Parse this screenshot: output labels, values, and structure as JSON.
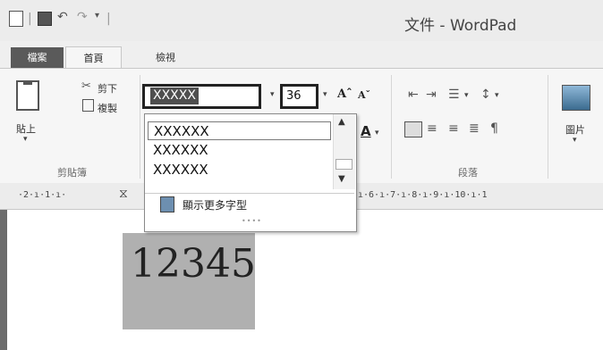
{
  "window": {
    "title": "文件 - WordPad"
  },
  "tabs": {
    "file": "檔案",
    "home": "首頁",
    "view": "檢視"
  },
  "clipboard": {
    "paste": "貼上",
    "cut": "剪下",
    "copy": "複製",
    "group_label": "剪貼簿"
  },
  "font": {
    "name_value": "XXXXX",
    "size_value": "36",
    "dropdown_items": [
      "XXXXXX",
      "XXXXXX",
      "XXXXXX"
    ],
    "more_fonts": "顯示更多字型"
  },
  "paragraph": {
    "group_label": "段落"
  },
  "insert": {
    "picture": "圖片"
  },
  "ruler": {
    "left_text": "·2·ı·1·ı·",
    "right_text": "ı·6·ı·7·ı·8·ı·9·ı·10·ı·1"
  },
  "document": {
    "sample_text": "12345"
  },
  "colors": {
    "selection": "#4f4f4f",
    "sample_bg": "#b0b0b0",
    "file_tab": "#5a5a5a"
  }
}
